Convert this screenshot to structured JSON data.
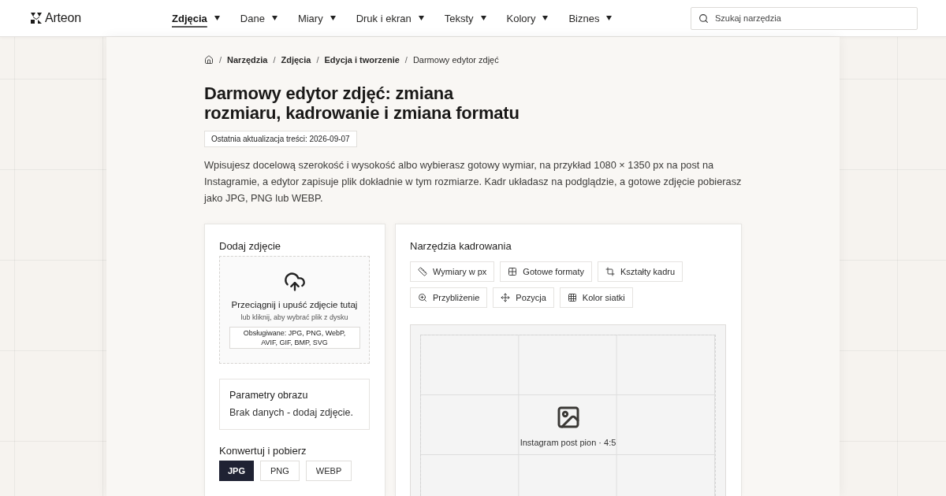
{
  "header": {
    "logo": "Arteon",
    "nav": [
      {
        "label": "Zdjęcia",
        "selected": true
      },
      {
        "label": "Dane",
        "selected": false
      },
      {
        "label": "Miary",
        "selected": false
      },
      {
        "label": "Druk i ekran",
        "selected": false
      },
      {
        "label": "Teksty",
        "selected": false
      },
      {
        "label": "Kolory",
        "selected": false
      },
      {
        "label": "Biznes",
        "selected": false
      }
    ],
    "search": {
      "placeholder": "Szukaj narzędzia"
    }
  },
  "breadcrumb": [
    {
      "separator": "/",
      "label": "Narzędzia",
      "current": false
    },
    {
      "separator": "/",
      "label": "Zdjęcia",
      "current": false
    },
    {
      "separator": "/",
      "label": "Edycja i tworzenie",
      "current": false
    },
    {
      "separator": "/",
      "label": "Darmowy edytor zdjęć",
      "current": true
    }
  ],
  "title": "Darmowy edytor zdjęć: zmiana rozmiaru, kadrowanie i zmiana formatu",
  "updated": "Ostatnia aktualizacja treści: 2026-09-07",
  "intro": "Wpisujesz docelową szerokość i wysokość albo wybierasz gotowy wymiar, na przykład 1080 × 1350 px na post na Instagramie, a edytor zapisuje plik dokładnie w tym rozmiarze. Kadr układasz na podglądzie, a gotowe zdjęcie pobierasz jako JPG, PNG lub WEBP.",
  "upload_panel": {
    "heading": "Dodaj zdjęcie",
    "dropzone": {
      "title": "Przeciągnij i upuść zdjęcie tutaj",
      "hint": "lub kliknij, aby wybrać plik z dysku",
      "formats": "Obsługiwane: JPG, PNG, WebP, AVIF, GIF, BMP, SVG"
    },
    "params": {
      "heading": "Parametry obrazu",
      "text": "Brak danych - dodaj zdjęcie."
    },
    "convert": {
      "heading": "Konwertuj i pobierz",
      "formats": [
        {
          "label": "JPG",
          "selected": true
        },
        {
          "label": "PNG",
          "selected": false
        },
        {
          "label": "WEBP",
          "selected": false
        }
      ]
    }
  },
  "crop_panel": {
    "heading": "Narzędzia kadrowania",
    "tools": [
      {
        "kind": "dimensions",
        "label": "Wymiary w px"
      },
      {
        "kind": "presets",
        "label": "Gotowe formaty"
      },
      {
        "kind": "shapes",
        "label": "Kształty kadru"
      },
      {
        "kind": "zoom",
        "label": "Przybliżenie"
      },
      {
        "kind": "position",
        "label": "Pozycja"
      },
      {
        "kind": "grid",
        "label": "Kolor siatki"
      }
    ],
    "preview": {
      "label": "Instagram post pion · 4:5"
    }
  }
}
